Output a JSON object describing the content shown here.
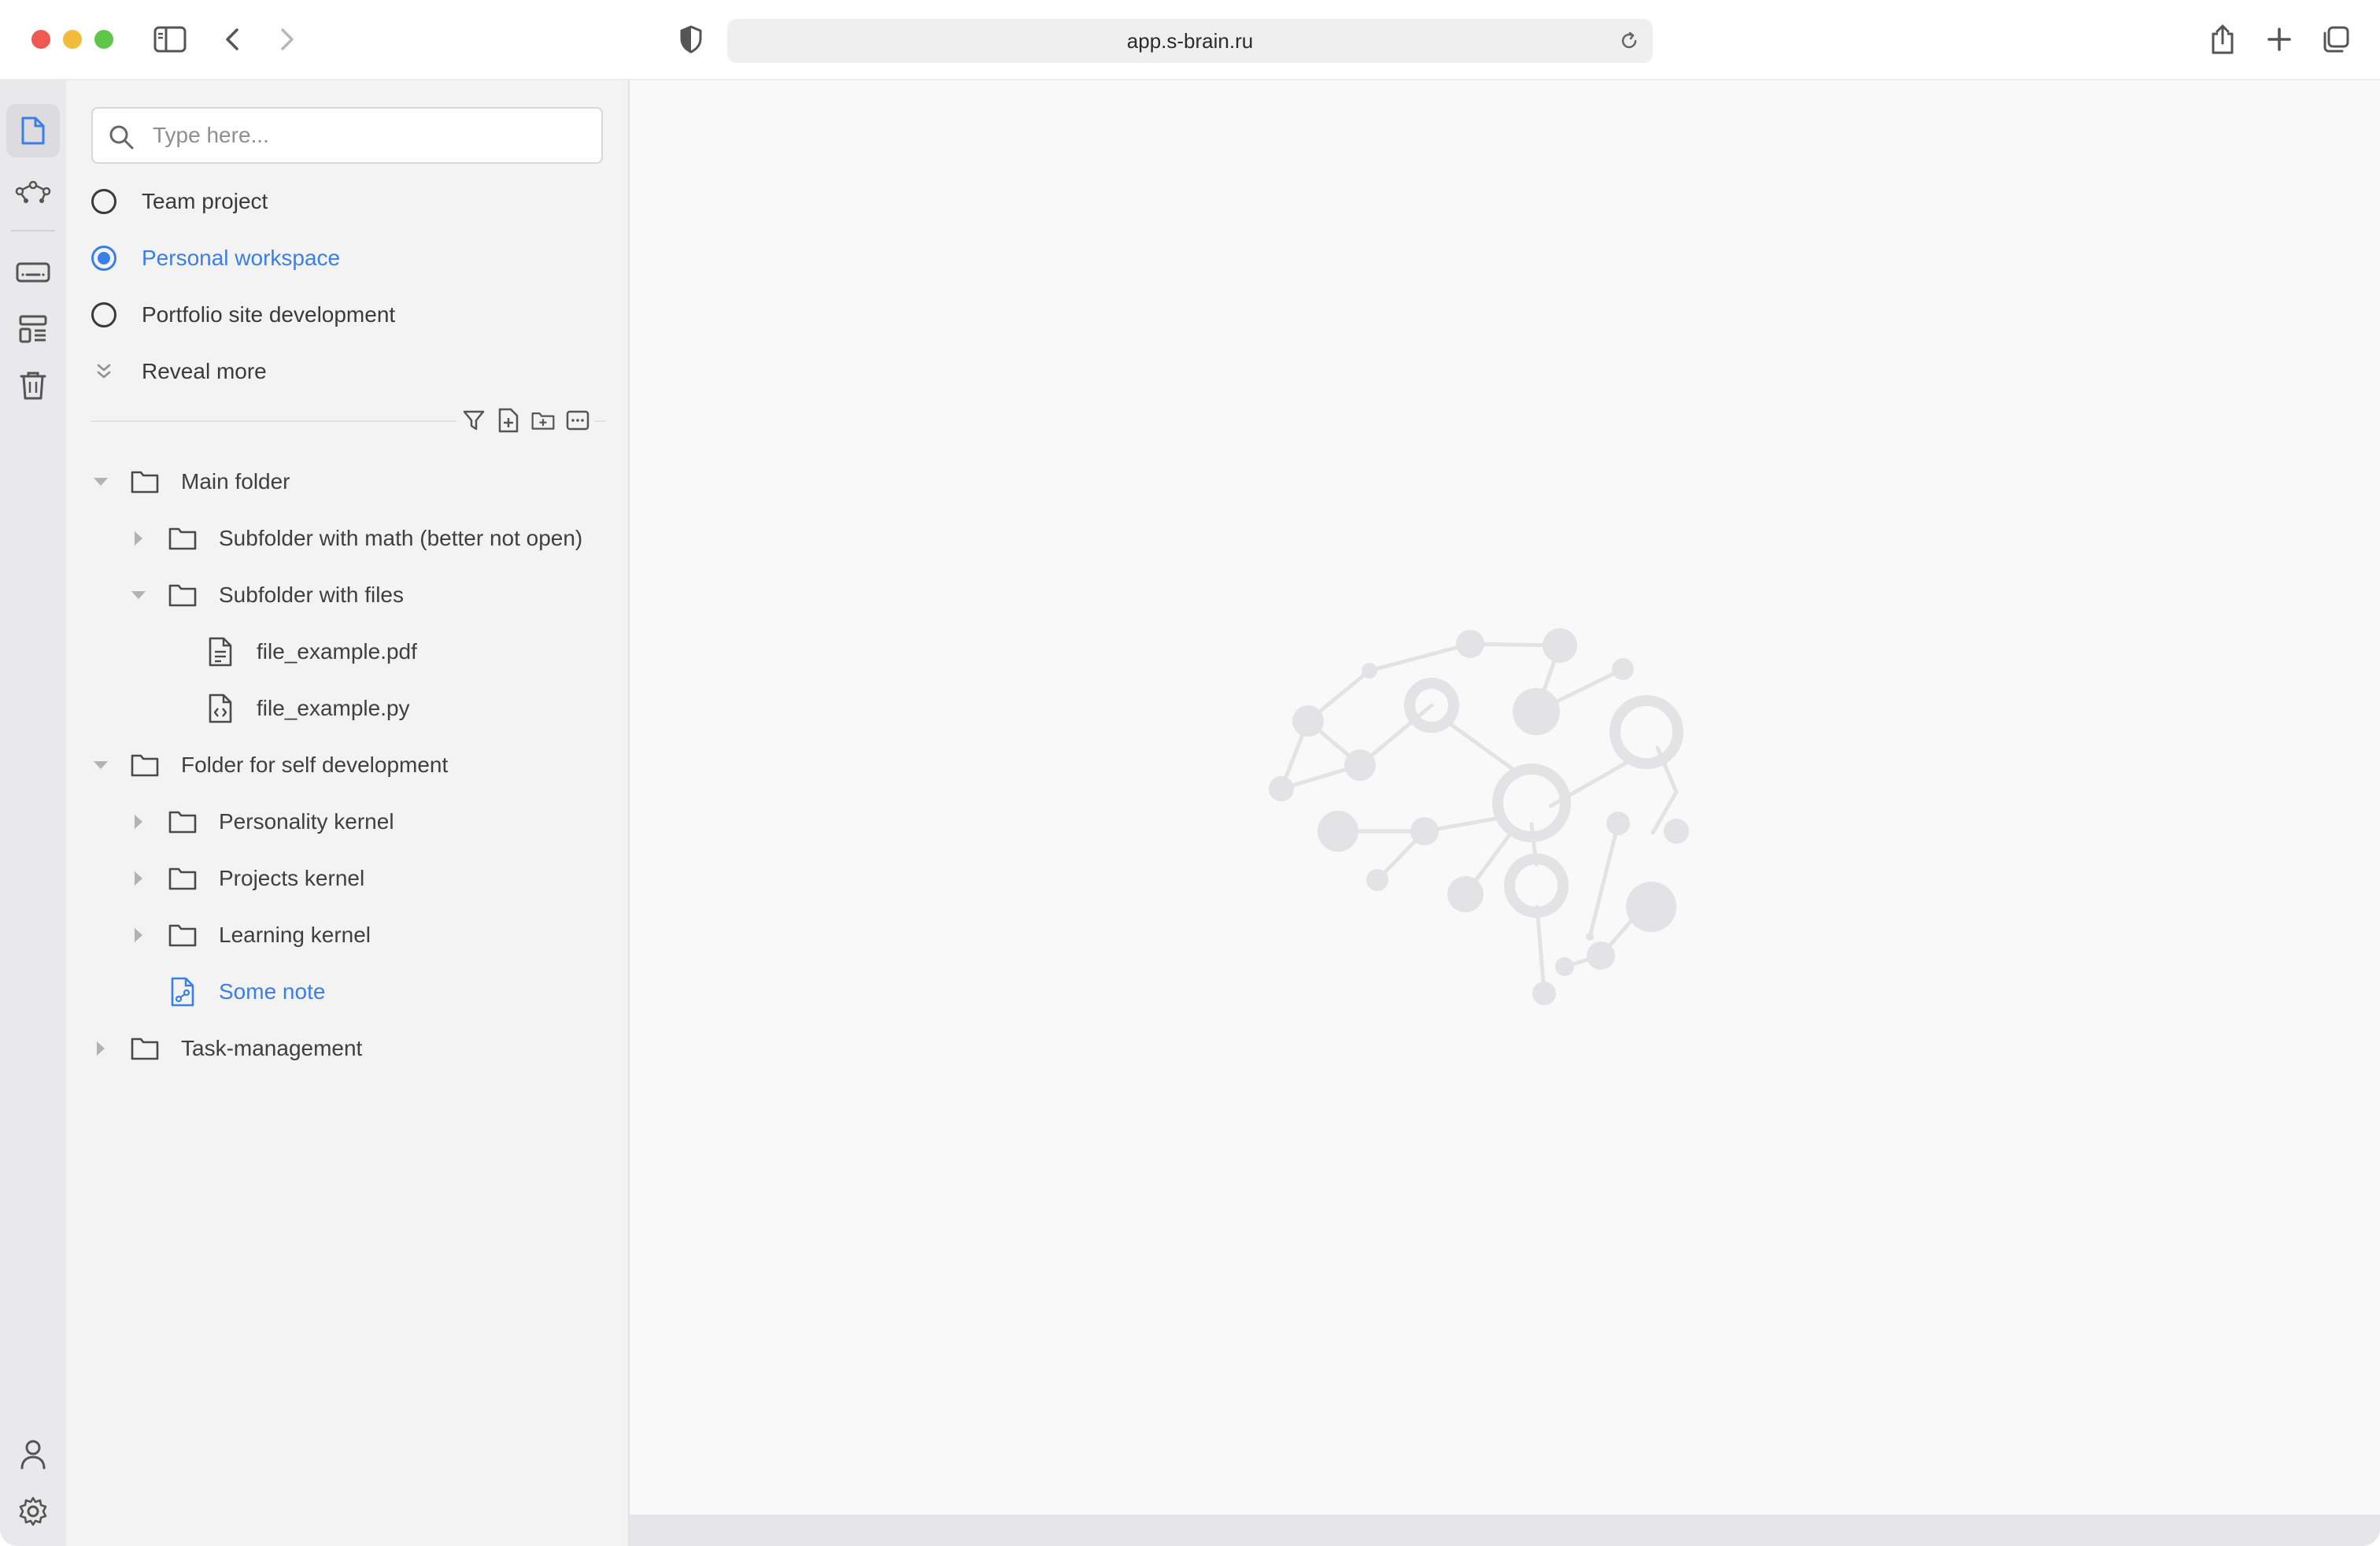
{
  "browser": {
    "url": "app.s-brain.ru"
  },
  "rail": {
    "top_items": [
      {
        "name": "documents-icon",
        "active": true
      },
      {
        "name": "graph-icon",
        "active": false
      },
      {
        "name": "keyboard-icon",
        "active": false
      },
      {
        "name": "templates-icon",
        "active": false
      },
      {
        "name": "trash-icon",
        "active": false
      }
    ],
    "bottom_items": [
      {
        "name": "profile-icon"
      },
      {
        "name": "settings-icon"
      }
    ]
  },
  "sidebar": {
    "search_placeholder": "Type here...",
    "workspaces": [
      {
        "label": "Team project",
        "selected": false
      },
      {
        "label": "Personal workspace",
        "selected": true
      },
      {
        "label": "Portfolio site development",
        "selected": false
      }
    ],
    "reveal_more_label": "Reveal more",
    "tree_action_icons": [
      "filter-icon",
      "new-file-icon",
      "new-folder-icon",
      "collapse-all-icon"
    ],
    "tree": {
      "main_folder": "Main folder",
      "subfolder_math": "Subfolder with math (better not open)",
      "subfolder_files": "Subfolder with files",
      "file_pdf": "file_example.pdf",
      "file_py": "file_example.py",
      "self_dev_folder": "Folder for self development",
      "personality_kernel": "Personality kernel",
      "projects_kernel": "Projects kernel",
      "learning_kernel": "Learning kernel",
      "some_note": "Some note",
      "task_management": "Task-management"
    }
  },
  "colors": {
    "accent": "#3a7ee8",
    "sidebar_bg": "#f3f3f4",
    "rail_bg": "#e9e9eb",
    "main_bg": "#f9f9f9",
    "brain_graphic": "#e3e3e5"
  }
}
